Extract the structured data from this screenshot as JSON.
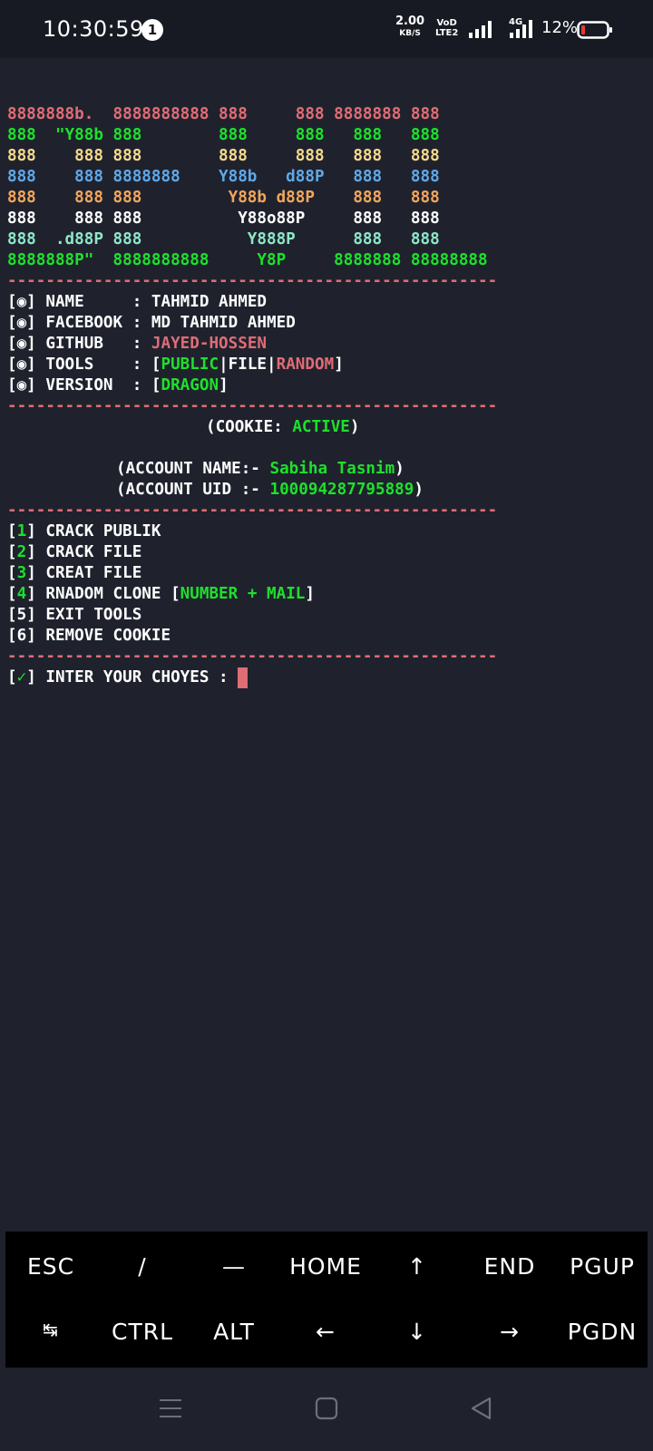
{
  "status_bar": {
    "time": "10:30:59",
    "notification_count": "1",
    "net_speed_value": "2.00",
    "net_speed_unit": "KB/S",
    "volte_top": "VoD",
    "volte_bottom": "LTE2",
    "network_type": "4G",
    "battery_percent": "12%"
  },
  "banner": [
    [
      "8888888b.  8888888888 888     888 8888888 888"
    ],
    [
      "888  \"Y88b 888        888     888   888   888"
    ],
    [
      "888    888 888        888     888   888   888"
    ],
    [
      "888    888 8888888    Y88b   d88P   888   888"
    ],
    [
      "888    888 888         Y88b d88P    888   888"
    ],
    [
      "888    888 888          Y88o88P     888   888"
    ],
    [
      "888  .d88P 888           Y888P      888   888"
    ],
    [
      "8888888P\"  8888888888     Y8P     8888888 88888888"
    ]
  ],
  "divider": "---------------------------------------------------",
  "info": {
    "bullet": "[◉]",
    "name_label": "NAME     : ",
    "name_value": "TAHMID AHMED",
    "facebook_label": "FACEBOOK : ",
    "facebook_value": "MD TAHMID AHMED",
    "github_label": "GITHUB   : ",
    "github_value": "JAYED-HOSSEN",
    "tools_label": "TOOLS    : ",
    "tools_public": "PUBLIC",
    "tools_file": "FILE",
    "tools_random": "RANDOM",
    "version_label": "VERSION  : ",
    "version_value": "DRAGON"
  },
  "cookie": {
    "prefix": "(COOKIE: ",
    "status": "ACTIVE",
    "suffix": ")"
  },
  "account": {
    "name_prefix": "(ACCOUNT NAME:- ",
    "name_value": "Sabiha Tasnim",
    "uid_prefix": "(ACCOUNT UID :- ",
    "uid_value": "100094287795889",
    "suffix": ")"
  },
  "menu": [
    {
      "num": "1",
      "label": "CRACK PUBLIK"
    },
    {
      "num": "2",
      "label": "CRACK FILE"
    },
    {
      "num": "3",
      "label": "CREAT FILE"
    },
    {
      "num": "4",
      "label": "RNADOM CLONE [",
      "extra": "NUMBER + MAIL",
      "extra_end": "]"
    },
    {
      "num": "5",
      "label": "EXIT TOOLS"
    },
    {
      "num": "6",
      "label": "REMOVE COOKIE"
    }
  ],
  "prompt": {
    "check": "✓",
    "text": " INTER YOUR CHOYES : "
  },
  "extra_keys": {
    "row1": [
      "ESC",
      "/",
      "—",
      "HOME",
      "↑",
      "END",
      "PGUP"
    ],
    "row2": [
      "↹",
      "CTRL",
      "ALT",
      "←",
      "↓",
      "→",
      "PGDN"
    ]
  },
  "colors": {
    "terminal_bg": "#1f222d",
    "red": "#e06c75",
    "green": "#1ee02c",
    "yellow": "#f6d98b",
    "blue": "#5fa8e8",
    "orange": "#f2a65a",
    "cyan": "#8fe6c8"
  }
}
